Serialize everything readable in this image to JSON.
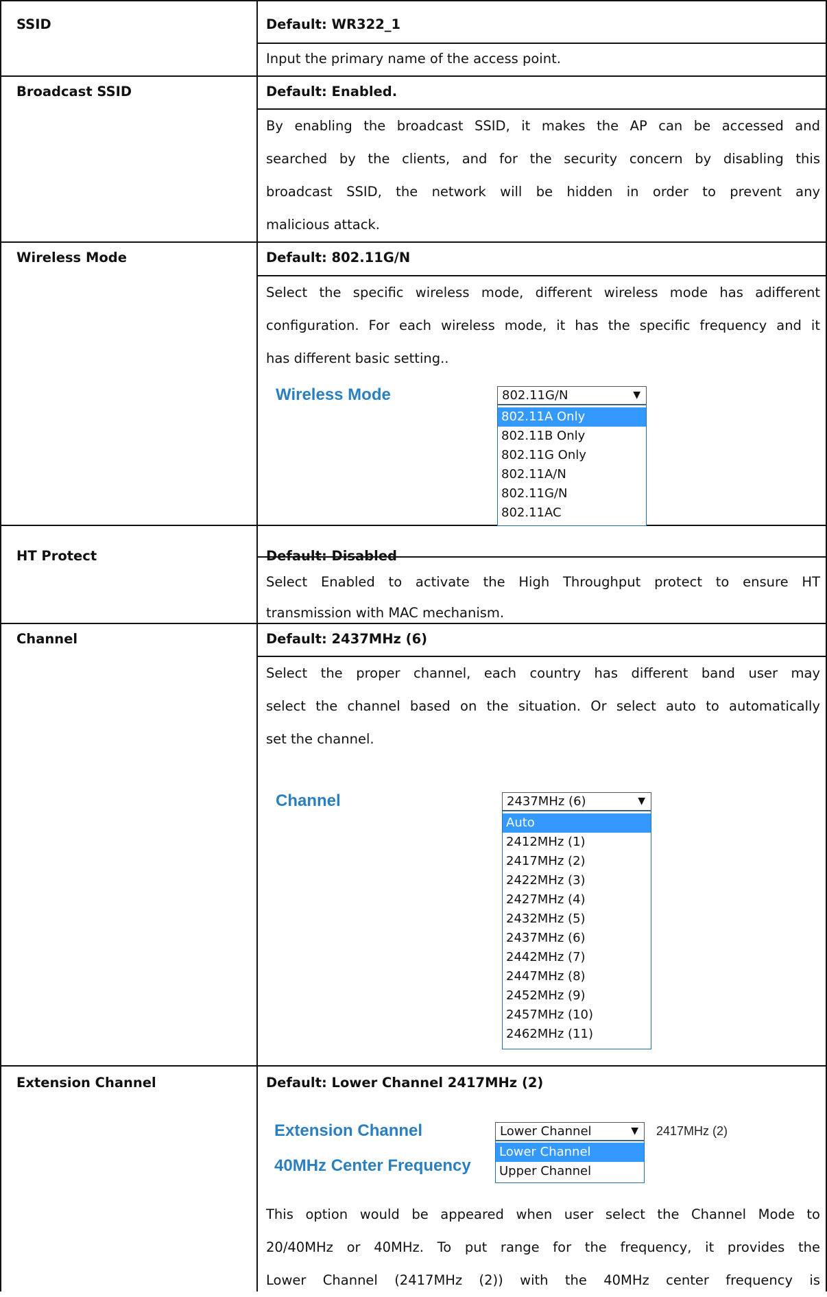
{
  "rows": [
    {
      "label": "SSID",
      "default": "Default: WR322_1",
      "lines": [
        "Input the primary name of the access point."
      ]
    },
    {
      "label": "Broadcast SSID",
      "default": "Default: Enabled.",
      "lines": [
        "By enabling the broadcast SSID, it makes the AP can be accessed and",
        "searched by the clients, and for the security concern by disabling this",
        "broadcast SSID, the network will be hidden in order to prevent any",
        "malicious attack."
      ]
    },
    {
      "label": "Wireless Mode",
      "default": "Default: 802.11G/N",
      "lines": [
        "Select the specific wireless mode, different wireless mode has adifferent",
        "configuration. For each wireless mode, it has the specific frequency and it",
        "has different basic setting.."
      ],
      "widget": {
        "label": "Wireless Mode",
        "selected": "802.11G/N",
        "options": [
          "802.11A Only",
          "802.11B Only",
          "802.11G Only",
          "802.11A/N",
          "802.11G/N",
          "802.11AC"
        ],
        "highlighted": "802.11A Only"
      }
    },
    {
      "label": "HT Protect",
      "default": "Default: Disabled",
      "lines": [
        "Select Enabled to activate the High Throughput protect to ensure HT",
        "transmission with MAC mechanism."
      ]
    },
    {
      "label": "Channel",
      "default": "Default: 2437MHz (6)",
      "lines": [
        "Select the proper channel, each country has different band user may",
        "select the channel based on the situation. Or select auto to automatically",
        "set the channel."
      ],
      "widget": {
        "label": "Channel",
        "selected": "2437MHz (6)",
        "options": [
          "Auto",
          "2412MHz (1)",
          "2417MHz (2)",
          "2422MHz (3)",
          "2427MHz (4)",
          "2432MHz (5)",
          "2437MHz (6)",
          "2442MHz (7)",
          "2447MHz (8)",
          "2452MHz (9)",
          "2457MHz (10)",
          "2462MHz (11)"
        ],
        "highlighted": "Auto"
      }
    },
    {
      "label": "Extension Channel",
      "default": "Default: Lower Channel 2417MHz (2)",
      "widget": {
        "label": "Extension Channel",
        "label2": "40MHz Center Frequency",
        "selected": "Lower Channel",
        "side_value": "2417MHz (2)",
        "options": [
          "Lower Channel",
          "Upper Channel"
        ],
        "highlighted": "Lower Channel"
      },
      "lines": [
        "This option would be appeared when user select the Channel Mode to",
        "20/40MHz or 40MHz. To put range for the frequency, it provides the",
        "Lower Channel (2417MHz (2)) with the 40MHz center frequency is"
      ]
    }
  ]
}
